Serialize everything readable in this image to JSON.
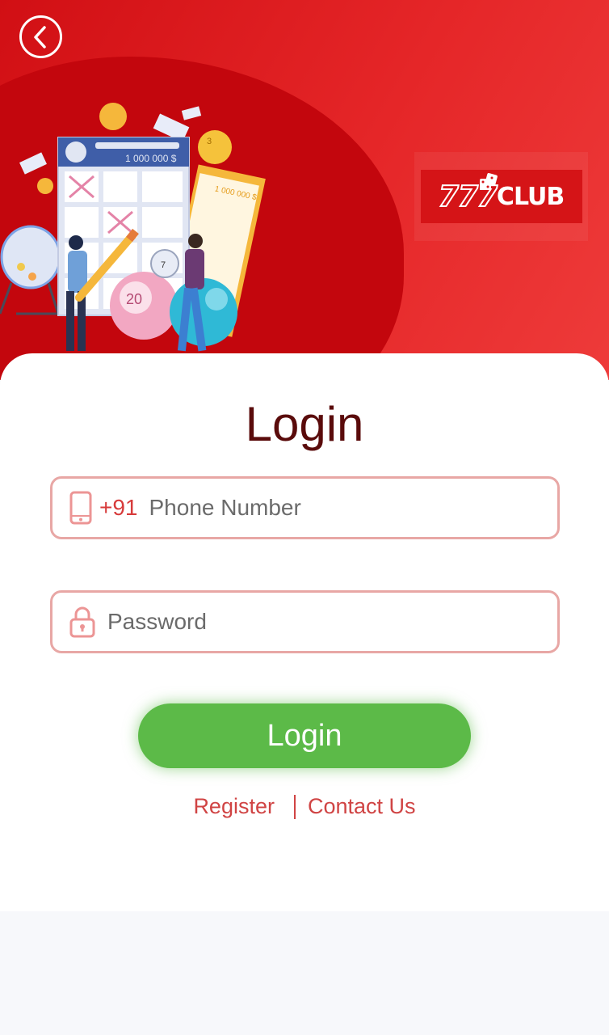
{
  "header": {
    "back_icon": "chevron-left-icon",
    "logo_text": "CLUB",
    "logo_number": "777",
    "illustration": {
      "ticket_amount": "1 000 000 $",
      "ticket_amount_2": "1 000 000 $",
      "ball_number": "20",
      "ball_number_small": "7",
      "coin_number": "3"
    }
  },
  "login": {
    "title": "Login",
    "phone": {
      "icon": "phone-icon",
      "prefix": "+91",
      "placeholder": "Phone Number",
      "value": ""
    },
    "password": {
      "icon": "lock-icon",
      "placeholder": "Password",
      "value": ""
    },
    "submit_label": "Login",
    "register_label": "Register",
    "contact_label": "Contact Us"
  },
  "colors": {
    "header_red": "#d10f14",
    "title": "#5a0b0b",
    "field_border": "#e8a7a5",
    "accent_red": "#d04444",
    "button_green": "#5cba48"
  }
}
